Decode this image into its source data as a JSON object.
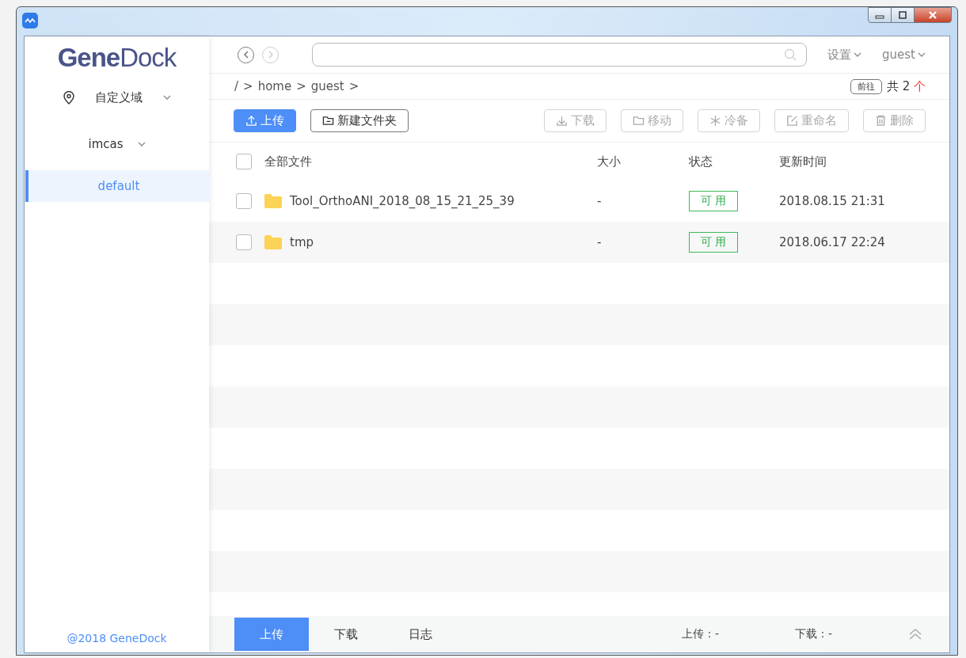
{
  "sidebar": {
    "logo": "**Gene**Dock",
    "region": {
      "label": "自定义域"
    },
    "account": {
      "label": "imcas"
    },
    "items": [
      {
        "label": "default",
        "selected": true
      }
    ],
    "footer": "@2018 GeneDock"
  },
  "topbar": {
    "back_disabled": false,
    "forward_disabled": true,
    "menus": [
      "设置",
      "guest"
    ]
  },
  "breadcrumb": {
    "parts": [
      "/",
      "home",
      "guest"
    ],
    "separator": ">",
    "goto": "前往",
    "count_prefix": "共 2",
    "count_suffix": "个"
  },
  "toolbar": [
    {
      "label": "上传",
      "kind": "primary",
      "disabled": false
    },
    {
      "label": "新建文件夹",
      "kind": "outline",
      "disabled": false
    },
    {
      "label": "下载",
      "kind": "outline",
      "disabled": true
    },
    {
      "label": "移动",
      "kind": "outline",
      "disabled": true
    },
    {
      "label": "冷备",
      "kind": "outline",
      "disabled": true
    },
    {
      "label": "重命名",
      "kind": "outline",
      "disabled": true
    },
    {
      "label": "删除",
      "kind": "outline",
      "disabled": true
    }
  ],
  "table": {
    "select_all_checked": false,
    "columns": [
      "全部文件",
      "大小",
      "状态",
      "更新时间"
    ],
    "rows": [
      {
        "name": "Tool_OrthoANI_2018_08_15_21_25_39",
        "size": "-",
        "status": "可 用",
        "updated": "2018.08.15 21:31",
        "checked": false
      },
      {
        "name": "tmp",
        "size": "-",
        "status": "可 用",
        "updated": "2018.06.17 22:24",
        "checked": false
      }
    ]
  },
  "bottom_bar": {
    "tabs": [
      {
        "label": "上传",
        "selected": true
      },
      {
        "label": "下载",
        "selected": false
      },
      {
        "label": "日志",
        "selected": false
      }
    ],
    "stats": [
      "上传：-",
      "下载：-"
    ]
  }
}
